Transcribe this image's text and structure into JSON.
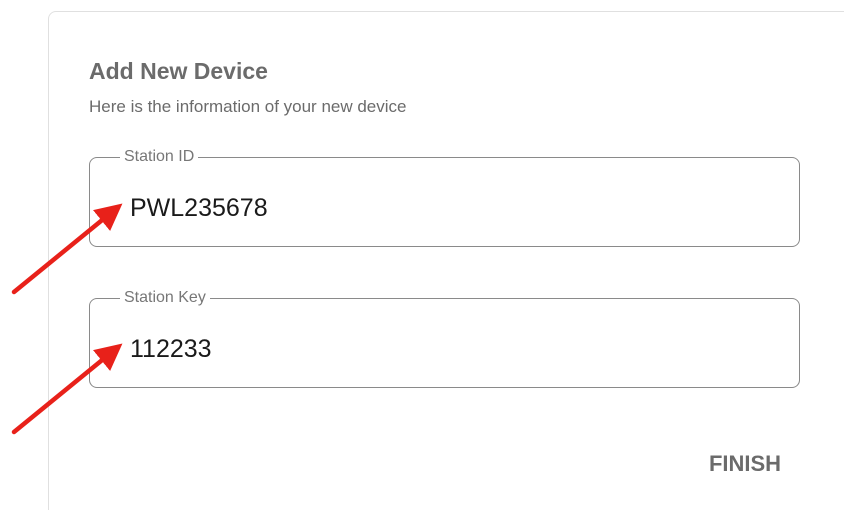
{
  "dialog": {
    "title": "Add New Device",
    "subtitle": "Here is the information of your new device"
  },
  "fields": {
    "station_id": {
      "label": "Station ID",
      "value": "PWL235678"
    },
    "station_key": {
      "label": "Station Key",
      "value": "112233"
    }
  },
  "actions": {
    "finish_label": "FINISH"
  },
  "annotations": {
    "arrow_color": "#e8211a"
  },
  "colors": {
    "text_muted": "#6b6b6b",
    "field_border": "#8a8a8a",
    "value_text": "#1a1a1a"
  }
}
